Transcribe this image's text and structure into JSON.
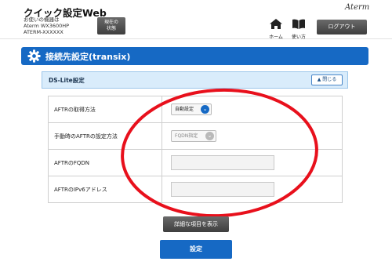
{
  "header": {
    "app_title": "クイック設定Web",
    "device_line1": "お使いの機器は",
    "device_line2": "Aterm WX3600HP",
    "device_line3": "ATERM-XXXXXX",
    "status_button_line1": "現在の",
    "status_button_line2": "状態",
    "brand": "Aterm",
    "home_label": "ホーム",
    "manual_label": "使い方",
    "logout_label": "ログアウト"
  },
  "section": {
    "title": "接続先設定(transix)"
  },
  "panel": {
    "title": "DS-Lite設定",
    "close_label": "閉じる"
  },
  "form": {
    "rows": [
      {
        "label": "AFTRの取得方法",
        "value": "自動設定"
      },
      {
        "label": "手動時のAFTRの設定方法",
        "value": "FQDN指定"
      },
      {
        "label": "AFTRのFQDN",
        "value": ""
      },
      {
        "label": "AFTRのIPv6アドレス",
        "value": ""
      }
    ]
  },
  "buttons": {
    "show_detail": "詳細な項目を表示",
    "submit": "設定"
  },
  "colors": {
    "accent": "#1669c4",
    "annotation": "#e8101c"
  }
}
